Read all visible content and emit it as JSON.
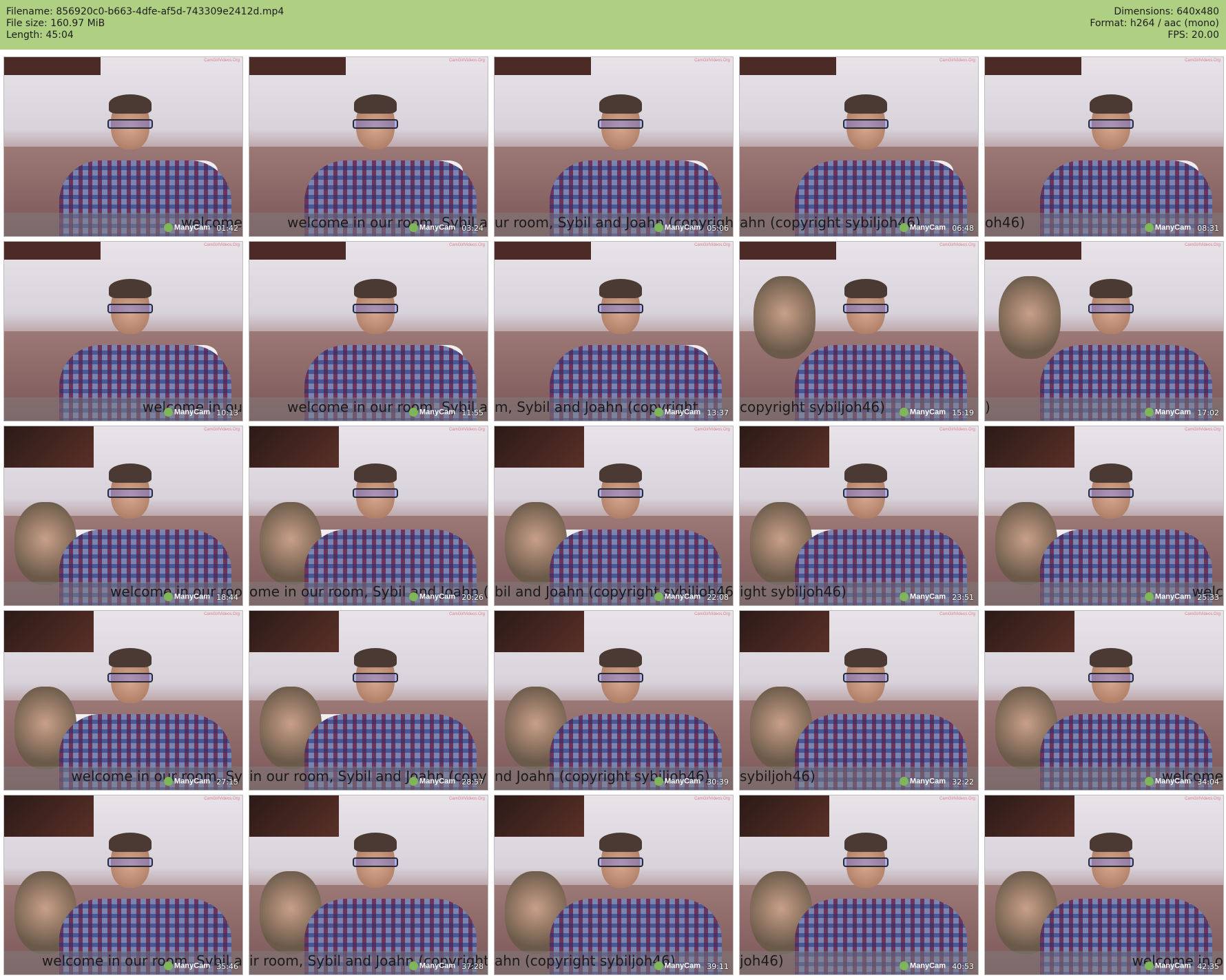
{
  "header": {
    "filename_label": "Filename:",
    "filename": "856920c0-b663-4dfe-af5d-743309e2412d.mp4",
    "filesize_label": "File size:",
    "filesize": "160.97 MiB",
    "length_label": "Length:",
    "length": "45:04",
    "dimensions_label": "Dimensions:",
    "dimensions": "640x480",
    "format_label": "Format:",
    "format": "h264 / aac (mono)",
    "fps_label": "FPS:",
    "fps": "20.00"
  },
  "watermark": {
    "logo_text": "ManyCam",
    "site_mark": "CamGirlVideos.Org"
  },
  "colors": {
    "header_bg": "#afcf83"
  },
  "thumbnails": [
    {
      "time": "01:42",
      "scroll": "welcome",
      "scroll_pos": "right",
      "woman": false
    },
    {
      "time": "03:24",
      "scroll": "welcome in our room, Sybil a",
      "scroll_pos": "mid",
      "woman": false
    },
    {
      "time": "05:06",
      "scroll": "ur room, Sybil and Joahn (copyright",
      "scroll_pos": "left",
      "woman": false
    },
    {
      "time": "06:48",
      "scroll": "ahn (copyright sybiljoh46)",
      "scroll_pos": "left",
      "woman": false
    },
    {
      "time": "08:31",
      "scroll": "oh46)",
      "scroll_pos": "left",
      "woman": false
    },
    {
      "time": "10:13",
      "scroll": "welcome in ou",
      "scroll_pos": "right",
      "woman": false
    },
    {
      "time": "11:55",
      "scroll": "welcome in our room, Sybil and Jo",
      "scroll_pos": "mid",
      "woman": false
    },
    {
      "time": "13:37",
      "scroll": "m, Sybil and Joahn (copyright",
      "scroll_pos": "left",
      "woman": false
    },
    {
      "time": "15:19",
      "scroll": "copyright sybiljoh46)",
      "scroll_pos": "left",
      "woman": true
    },
    {
      "time": "17:02",
      "scroll": ")",
      "scroll_pos": "left",
      "woman": true
    },
    {
      "time": "18:44",
      "scroll": "welcome in our roo",
      "scroll_pos": "right",
      "woman": true
    },
    {
      "time": "20:26",
      "scroll": "ome in our room, Sybil and Joahn (c",
      "scroll_pos": "left",
      "woman": true
    },
    {
      "time": "22:08",
      "scroll": "bil and Joahn (copyright sybiljoh46",
      "scroll_pos": "left",
      "woman": true
    },
    {
      "time": "23:51",
      "scroll": "ight sybiljoh46)",
      "scroll_pos": "left",
      "woman": true
    },
    {
      "time": "25:33",
      "scroll": "welc",
      "scroll_pos": "right",
      "woman": true
    },
    {
      "time": "27:15",
      "scroll": "welcome in our room, Sy",
      "scroll_pos": "right",
      "woman": true
    },
    {
      "time": "28:57",
      "scroll": "in our room, Sybil and Joahn (copyri",
      "scroll_pos": "left",
      "woman": true
    },
    {
      "time": "30:39",
      "scroll": "nd Joahn (copyright sybiljoh46)",
      "scroll_pos": "left",
      "woman": true
    },
    {
      "time": "32:22",
      "scroll": "sybiljoh46)",
      "scroll_pos": "left",
      "woman": true
    },
    {
      "time": "34:04",
      "scroll": "welcome",
      "scroll_pos": "right",
      "woman": true
    },
    {
      "time": "35:46",
      "scroll": "welcome in our room, Sybil a",
      "scroll_pos": "right",
      "woman": true
    },
    {
      "time": "37:28",
      "scroll": "ir room, Sybil and Joahn (copyright",
      "scroll_pos": "left",
      "woman": true
    },
    {
      "time": "39:11",
      "scroll": "ahn (copyright sybiljoh46)",
      "scroll_pos": "left",
      "woman": true
    },
    {
      "time": "40:53",
      "scroll": "joh46)",
      "scroll_pos": "left",
      "woman": true
    },
    {
      "time": "42:35",
      "scroll": "welcome in o",
      "scroll_pos": "right",
      "woman": true
    }
  ]
}
